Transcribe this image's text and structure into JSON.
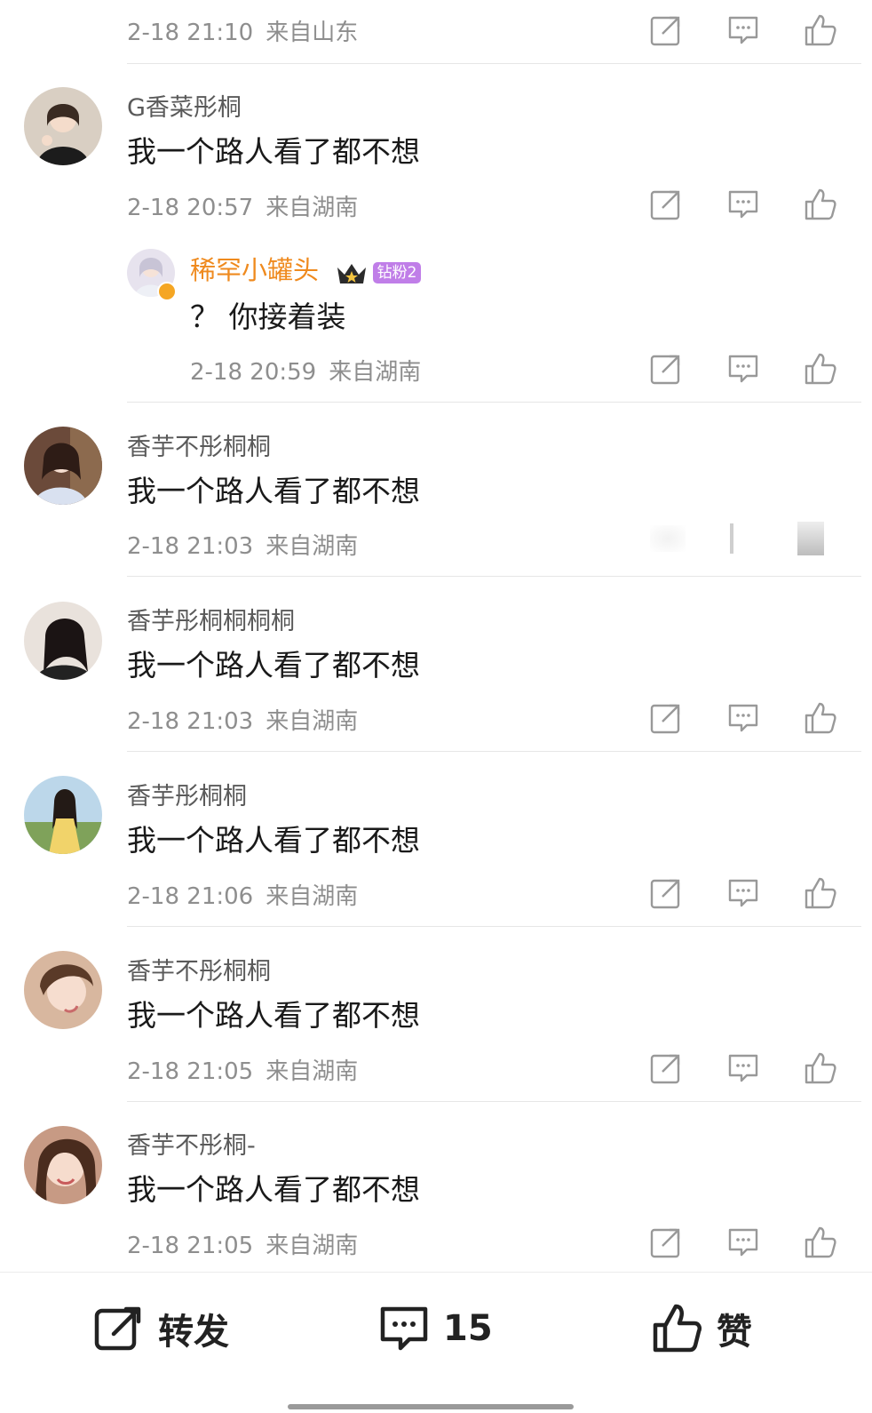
{
  "top_meta": {
    "time": "2-18 21:10",
    "location": "来自山东"
  },
  "comments": [
    {
      "name": "G香菜彤桐",
      "text": "我一个路人看了都不想",
      "time": "2-18 20:57",
      "location": "来自湖南"
    },
    {
      "name": "香芋不彤桐桐",
      "text": "我一个路人看了都不想",
      "time": "2-18 21:03",
      "location": "来自湖南"
    },
    {
      "name": "香芋彤桐桐桐桐",
      "text": "我一个路人看了都不想",
      "time": "2-18 21:03",
      "location": "来自湖南"
    },
    {
      "name": "香芋彤桐桐",
      "text": "我一个路人看了都不想",
      "time": "2-18 21:06",
      "location": "来自湖南"
    },
    {
      "name": "香芋不彤桐桐",
      "text": "我一个路人看了都不想",
      "time": "2-18 21:05",
      "location": "来自湖南"
    },
    {
      "name": "香芋不彤桐-",
      "text": "我一个路人看了都不想",
      "time": "2-18 21:05",
      "location": "来自湖南"
    }
  ],
  "reply": {
    "name": "稀罕小罐头",
    "badge": "钻粉2",
    "text": "？ 你接着装",
    "time": "2-18 20:59",
    "location": "来自湖南"
  },
  "icons": {
    "share": "share-icon",
    "reply": "comment-icon",
    "like": "thumbs-up-icon"
  },
  "bottom_bar": {
    "share_label": "转发",
    "comment_count": "15",
    "like_label": "赞"
  },
  "colors": {
    "reply_name": "#ef8a1e",
    "badge": "#c07ee8",
    "meta": "#8e8e8e"
  }
}
